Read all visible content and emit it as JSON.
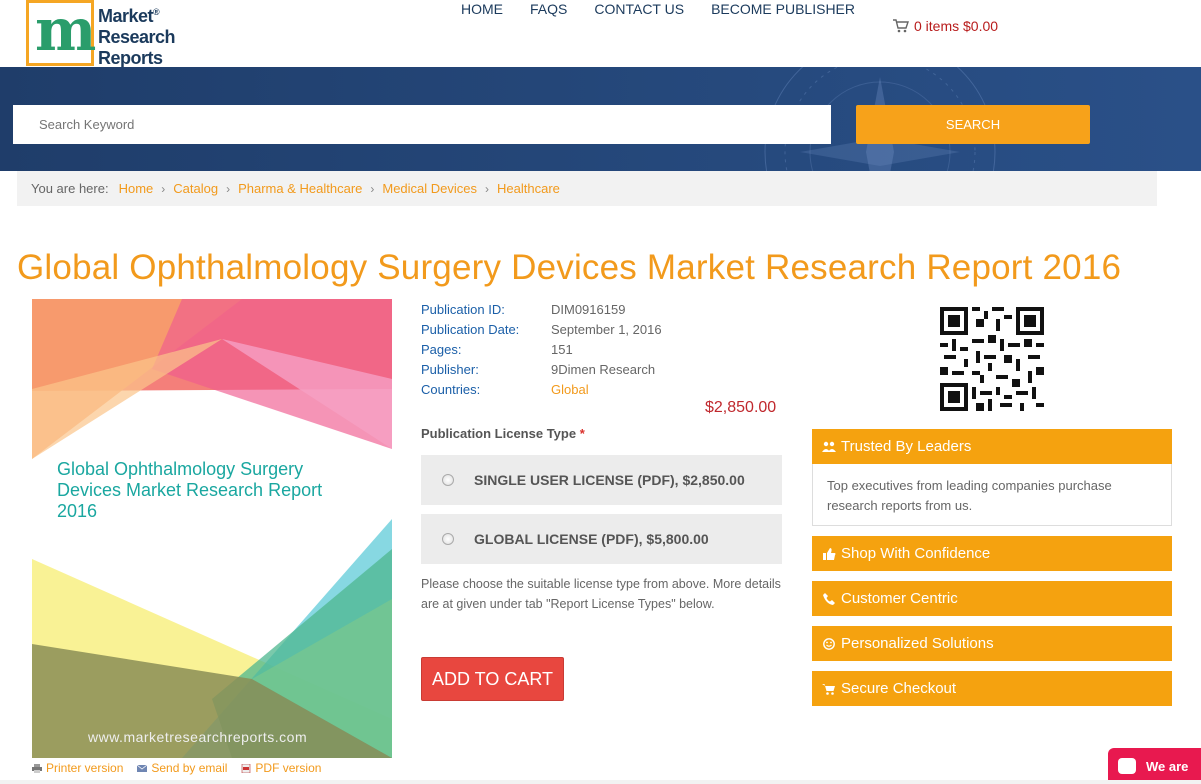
{
  "logo": {
    "mark": "m",
    "line1": "Market",
    "reg": "®",
    "line2": "Research",
    "line3": "Reports"
  },
  "nav": [
    "HOME",
    "FAQS",
    "CONTACT US",
    "BECOME PUBLISHER"
  ],
  "cart": {
    "label": "0 items $0.00",
    "icon": "shopping-cart-icon"
  },
  "search": {
    "placeholder": "Search Keyword",
    "button": "SEARCH"
  },
  "breadcrumb": {
    "prefix": "You are here:",
    "items": [
      "Home",
      "Catalog",
      "Pharma & Healthcare",
      "Medical Devices",
      "Healthcare"
    ]
  },
  "title": "Global Ophthalmology Surgery Devices Market Research Report 2016",
  "cover": {
    "title": "Global Ophthalmology Surgery Devices Market Research Report 2016",
    "url": "www.marketresearchreports.com"
  },
  "tools": [
    "Printer version",
    "Send by email",
    "PDF version"
  ],
  "meta": [
    {
      "key": "Publication ID:",
      "value": "DIM0916159"
    },
    {
      "key": "Publication Date:",
      "value": "September 1, 2016"
    },
    {
      "key": "Pages:",
      "value": "151"
    },
    {
      "key": "Publisher:",
      "value": "9Dimen Research"
    },
    {
      "key": "Countries:",
      "value": "Global"
    }
  ],
  "price": "$2,850.00",
  "license": {
    "label": "Publication License Type",
    "required": "*",
    "options": [
      "SINGLE USER LICENSE (PDF), $2,850.00",
      "GLOBAL LICENSE (PDF), $5,800.00"
    ],
    "note": "Please choose the suitable license type from above. More details are at given under tab \"Report License Types\" below."
  },
  "add_to_cart": "ADD TO CART",
  "trusted": {
    "heading": "Trusted By Leaders",
    "body": "Top executives from leading companies purchase research reports from us."
  },
  "features": [
    "Shop With Confidence",
    "Customer Centric",
    "Personalized Solutions",
    "Secure Checkout"
  ],
  "chat": {
    "label": "We are"
  },
  "colors": {
    "accent": "#f5a20f",
    "link": "#f29a1c",
    "navy": "#1b3a5c",
    "cta": "#e8473f",
    "price": "#c0282d"
  }
}
